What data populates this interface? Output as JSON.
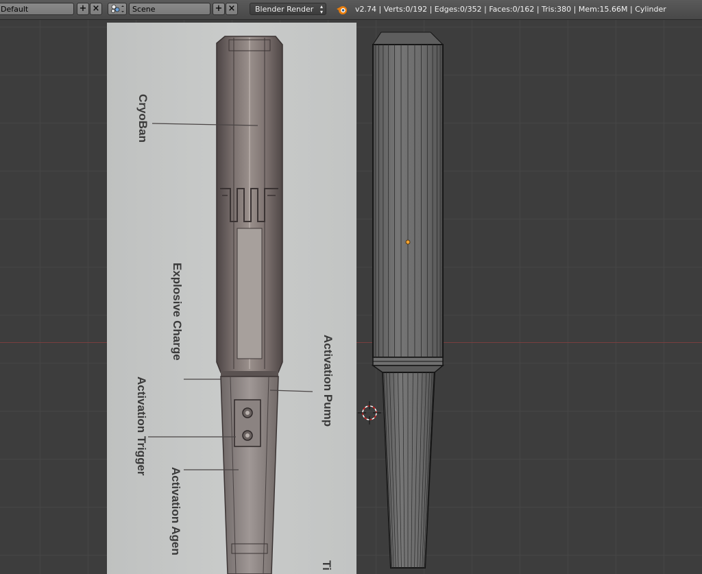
{
  "header": {
    "screen_layout": "Default",
    "scene_name": "Scene",
    "render_engine": "Blender Render",
    "add_symbol": "+",
    "close_symbol": "×",
    "stats": "v2.74 | Verts:0/192 | Edges:0/352 | Faces:0/162 | Tris:380 | Mem:15.66M | Cylinder"
  },
  "reference_labels": {
    "cryoban": "CryoBan",
    "explosive_charge": "Explosive Charge",
    "activation_pump": "Activation Pump",
    "activation_trigger": "Activation Trigger",
    "activation_agent": "Activation Agen",
    "bottom_partial": "Ti"
  },
  "colors": {
    "viewport_bg": "#3d3d3d",
    "grid_line": "#464646",
    "x_axis": "#7a3e3e",
    "mesh_fill": "#6b6b6b",
    "mesh_edge": "#151515",
    "origin_dot": "#f0a030"
  },
  "icons": [
    "add-icon",
    "close-icon",
    "scene-icon",
    "blender-logo-icon",
    "3d-cursor-icon"
  ]
}
